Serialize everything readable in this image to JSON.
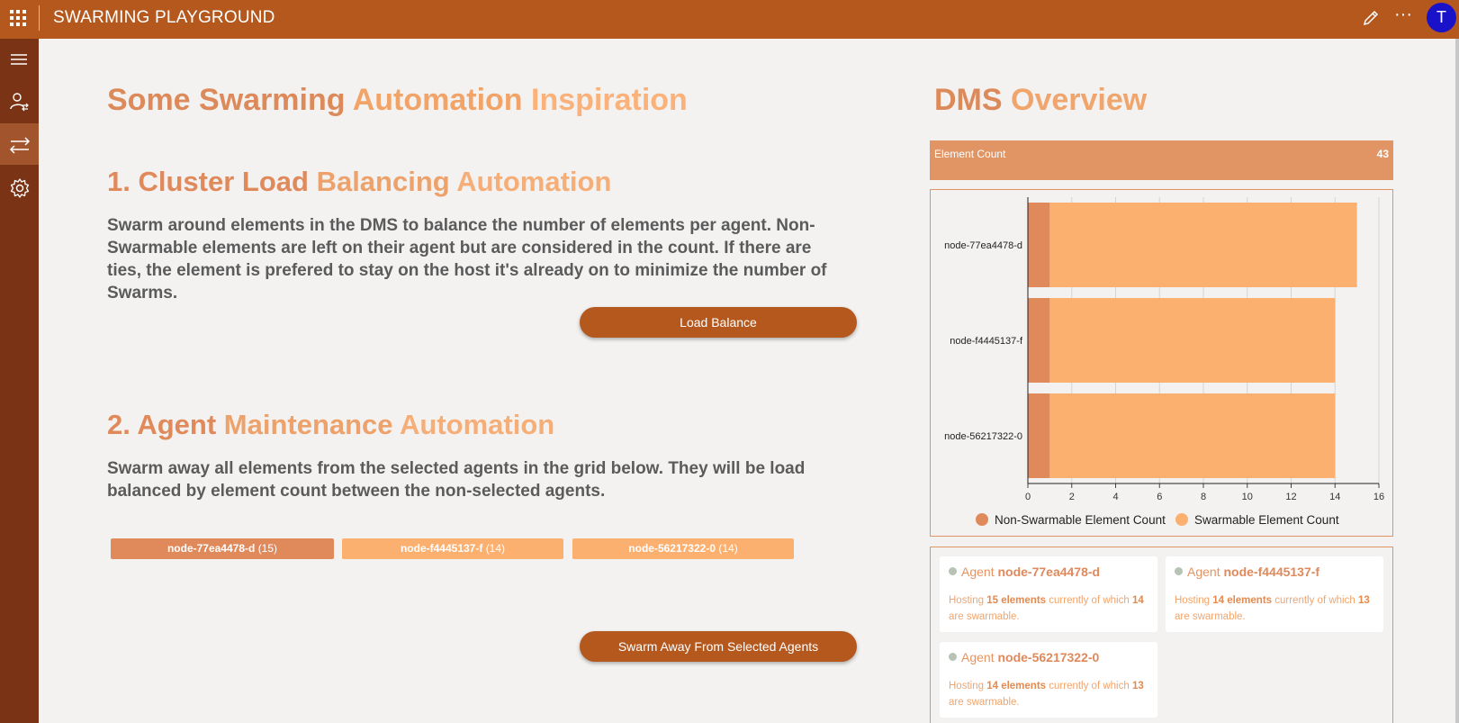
{
  "app": {
    "title": "SWARMING PLAYGROUND",
    "user_initial": "T"
  },
  "colors": {
    "brand": "#b5581e",
    "rail": "#7a3315",
    "non_swarmable": "#e0895b",
    "swarmable": "#fcb070"
  },
  "main": {
    "title_parts": [
      "Some Swarming",
      "Automation",
      "Inspiration"
    ],
    "section1": {
      "title_parts": [
        "1. Cluster Load",
        "Balancing",
        "Automation"
      ],
      "description": "Swarm around elements in the DMS to balance the number of elements per agent. Non-Swarmable elements are left on their agent but are considered in the count. If there are ties, the element is prefered to stay on the host it's already on to minimize the number of Swarms.",
      "button": "Load Balance"
    },
    "section2": {
      "title_parts": [
        "2. Agent",
        "Maintenance",
        "Automation"
      ],
      "description": "Swarm away all elements from the selected agents in the grid below. They will be load balanced by element count between the non-selected agents.",
      "button": "Swarm Away From Selected Agents",
      "agents": [
        {
          "name": "node-77ea4478-d",
          "count": "(15)",
          "selected": true
        },
        {
          "name": "node-f4445137-f",
          "count": "(14)",
          "selected": false
        },
        {
          "name": "node-56217322-0",
          "count": "(14)",
          "selected": false
        }
      ]
    }
  },
  "overview": {
    "title_parts": [
      "DMS",
      "Overview"
    ],
    "element_count_label": "Element Count",
    "element_count_value": "43",
    "chart_data": {
      "type": "bar",
      "orientation": "horizontal",
      "stacked": true,
      "categories": [
        "node-77ea4478-d",
        "node-f4445137-f",
        "node-56217322-0"
      ],
      "series": [
        {
          "name": "Non-Swarmable Element Count",
          "values": [
            1,
            1,
            1
          ]
        },
        {
          "name": "Swarmable Element Count",
          "values": [
            14,
            13,
            13
          ]
        }
      ],
      "xlim": [
        0,
        16
      ],
      "xticks": [
        "0",
        "2",
        "4",
        "6",
        "8",
        "10",
        "12",
        "14",
        "16"
      ],
      "grid": true,
      "legend": "bottom"
    },
    "agent_cards": [
      {
        "prefix": "Agent",
        "name": "node-77ea4478-d",
        "t1": "Hosting",
        "total": "15 elements",
        "t2": "currently of which",
        "swarmable": "14",
        "t3": "are swarmable."
      },
      {
        "prefix": "Agent",
        "name": "node-f4445137-f",
        "t1": "Hosting",
        "total": "14 elements",
        "t2": "currently of which",
        "swarmable": "13",
        "t3": "are swarmable."
      },
      {
        "prefix": "Agent",
        "name": "node-56217322-0",
        "t1": "Hosting",
        "total": "14 elements",
        "t2": "currently of which",
        "swarmable": "13",
        "t3": "are swarmable."
      }
    ]
  }
}
